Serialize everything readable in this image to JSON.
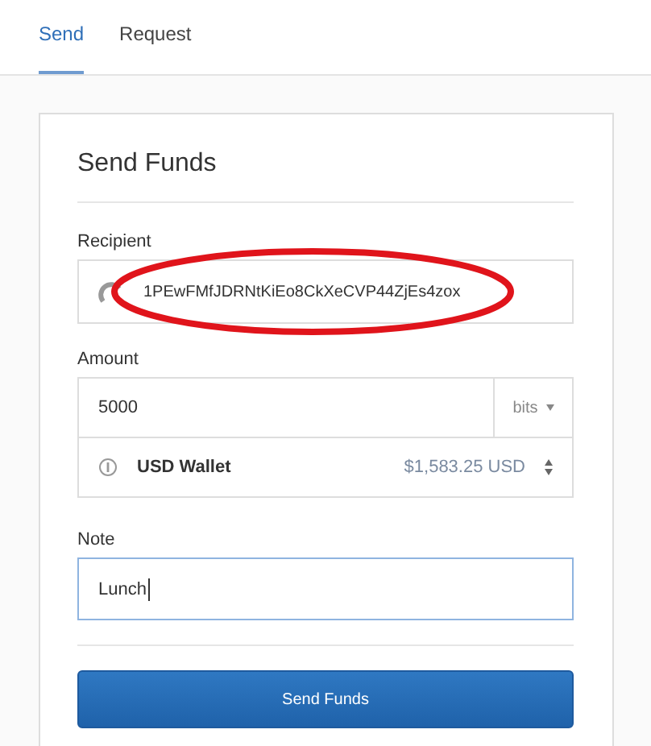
{
  "tabs": [
    {
      "label": "Send",
      "selected": true
    },
    {
      "label": "Request",
      "selected": false
    }
  ],
  "form": {
    "title": "Send Funds",
    "recipient": {
      "label": "Recipient",
      "value": "1PEwFMfJDRNtKiEo8CkXeCVP44ZjEs4zox",
      "circled": true
    },
    "amount": {
      "label": "Amount",
      "value": "5000",
      "unit": "bits",
      "wallet": "USD Wallet",
      "balance": "$1,583.25 USD"
    },
    "note": {
      "label": "Note",
      "value": "Lunch",
      "focused": true
    },
    "submit": "Send Funds"
  }
}
